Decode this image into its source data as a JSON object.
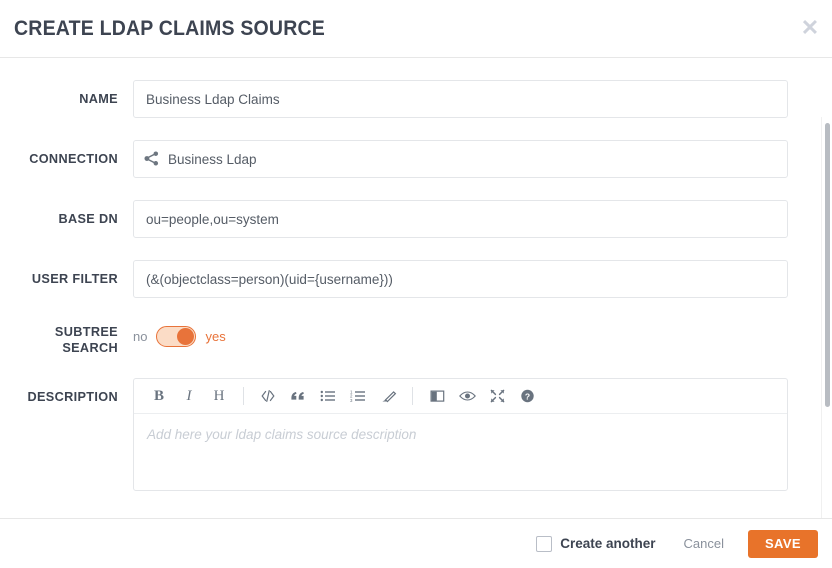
{
  "header": {
    "title": "CREATE LDAP CLAIMS SOURCE",
    "close_label": "✕",
    "close_icon": "close-icon"
  },
  "form": {
    "name": {
      "label": "NAME",
      "value": "Business Ldap Claims",
      "placeholder": ""
    },
    "connection": {
      "label": "CONNECTION",
      "value": "Business Ldap",
      "placeholder": "",
      "icon": "share-alt-icon"
    },
    "base_dn": {
      "label": "BASE DN",
      "value": "ou=people,ou=system",
      "placeholder": ""
    },
    "user_filter": {
      "label": "USER FILTER",
      "value": "(&(objectclass=person)(uid={username}))",
      "placeholder": ""
    },
    "subtree_search": {
      "label": "SUBTREE SEARCH",
      "off_label": "no",
      "on_label": "yes",
      "state": "yes"
    },
    "description": {
      "label": "DESCRIPTION",
      "placeholder": "Add here your ldap claims source description",
      "value": "",
      "toolbar": [
        {
          "name": "bold-icon",
          "glyph": "B",
          "title": "Bold"
        },
        {
          "name": "italic-icon",
          "glyph": "I",
          "title": "Italic"
        },
        {
          "name": "heading-icon",
          "glyph": "H",
          "title": "Heading"
        },
        {
          "name": "code-icon",
          "glyph": "</>",
          "title": "Code"
        },
        {
          "name": "quote-icon",
          "glyph": "❝",
          "title": "Quote"
        },
        {
          "name": "unordered-list-icon",
          "glyph": "",
          "title": "Generic List"
        },
        {
          "name": "ordered-list-icon",
          "glyph": "",
          "title": "Numbered List"
        },
        {
          "name": "eraser-icon",
          "glyph": "",
          "title": "Clean block"
        },
        {
          "name": "side-by-side-icon",
          "glyph": "",
          "title": "Toggle Side by Side"
        },
        {
          "name": "preview-icon",
          "glyph": "",
          "title": "Toggle Preview"
        },
        {
          "name": "fullscreen-icon",
          "glyph": "",
          "title": "Toggle Fullscreen"
        },
        {
          "name": "help-icon",
          "glyph": "",
          "title": "Markdown Guide"
        }
      ]
    }
  },
  "footer": {
    "create_another_label": "Create another",
    "create_another_checked": false,
    "cancel_label": "Cancel",
    "save_label": "SAVE"
  },
  "colors": {
    "accent": "#e8732a",
    "toggle_track": "#fbdcc6",
    "title": "#3d4451",
    "muted": "#8a919c",
    "border": "#e4e6e9"
  }
}
